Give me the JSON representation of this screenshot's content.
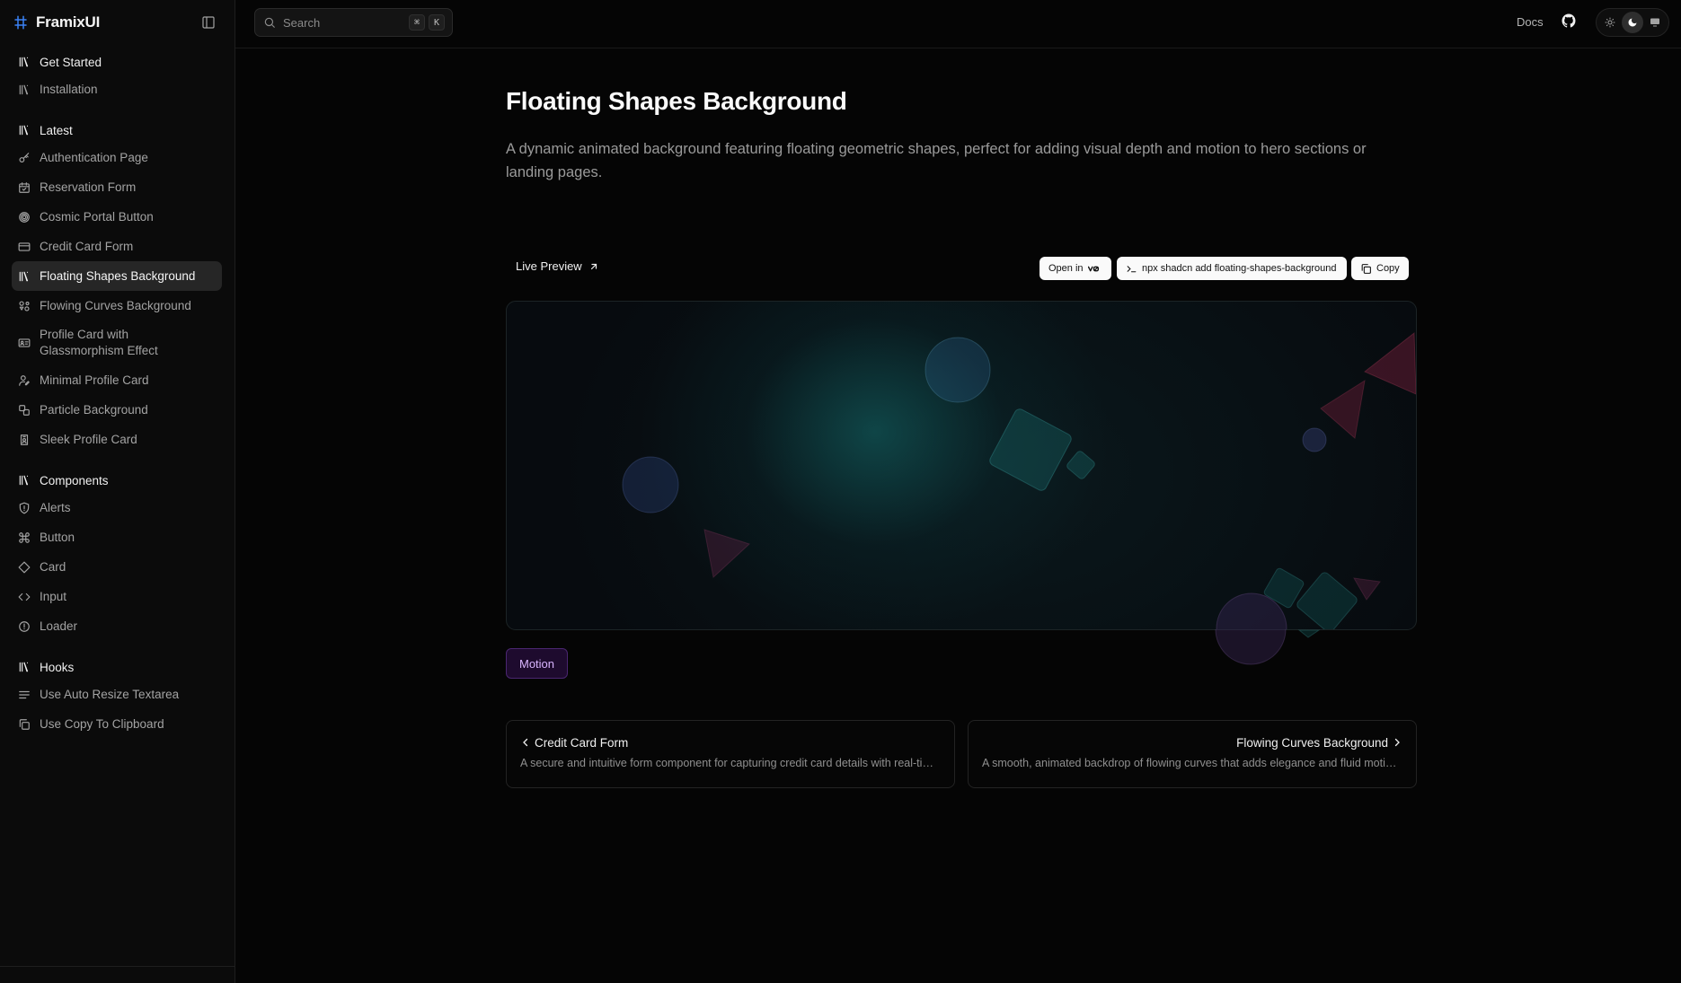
{
  "app": {
    "name": "FramixUI"
  },
  "sidebar": {
    "sections": [
      {
        "title": "Get Started",
        "icon": "library-icon",
        "items": [
          {
            "label": "Installation",
            "icon": "library-icon"
          }
        ]
      },
      {
        "title": "Latest",
        "icon": "library-icon",
        "items": [
          {
            "label": "Authentication Page",
            "icon": "key-icon"
          },
          {
            "label": "Reservation Form",
            "icon": "calendar-check-icon"
          },
          {
            "label": "Cosmic Portal Button",
            "icon": "target-icon"
          },
          {
            "label": "Credit Card Form",
            "icon": "credit-card-icon"
          },
          {
            "label": "Floating Shapes Background",
            "icon": "library-icon",
            "active": true
          },
          {
            "label": "Flowing Curves Background",
            "icon": "shapes-icon"
          },
          {
            "label": "Profile Card with Glassmorphism Effect",
            "icon": "id-card-icon"
          },
          {
            "label": "Minimal Profile Card",
            "icon": "user-pen-icon"
          },
          {
            "label": "Particle Background",
            "icon": "blend-icon"
          },
          {
            "label": "Sleek Profile Card",
            "icon": "badge-user-icon"
          }
        ]
      },
      {
        "title": "Components",
        "icon": "library-icon",
        "items": [
          {
            "label": "Alerts",
            "icon": "shield-alert-icon"
          },
          {
            "label": "Button",
            "icon": "command-icon"
          },
          {
            "label": "Card",
            "icon": "diamond-icon"
          },
          {
            "label": "Input",
            "icon": "code-icon"
          },
          {
            "label": "Loader",
            "icon": "alert-circle-icon"
          }
        ]
      },
      {
        "title": "Hooks",
        "icon": "library-icon",
        "items": [
          {
            "label": "Use Auto Resize Textarea",
            "icon": "text-lines-icon"
          },
          {
            "label": "Use Copy To Clipboard",
            "icon": "copy-icon"
          }
        ]
      }
    ]
  },
  "topbar": {
    "search_placeholder": "Search",
    "shortcut_mod": "⌘",
    "shortcut_key": "K",
    "docs_label": "Docs"
  },
  "page": {
    "title": "Floating Shapes Background",
    "description": "A dynamic animated background featuring floating geometric shapes, perfect for adding visual depth and motion to hero sections or landing pages."
  },
  "preview_bar": {
    "live_preview_label": "Live Preview",
    "open_in_label": "Open in",
    "cli_command": "npx shadcn add floating-shapes-background",
    "copy_label": "Copy"
  },
  "tags": [
    "Motion"
  ],
  "pager": {
    "prev": {
      "title": "Credit Card Form",
      "description": "A secure and intuitive form component for capturing credit card details with real-time validation and formatting."
    },
    "next": {
      "title": "Flowing Curves Background",
      "description": "A smooth, animated backdrop of flowing curves that adds elegance and fluid motion to your pages."
    }
  },
  "colors": {
    "accent": "#3b82f6",
    "tag_text": "#d8b4fe",
    "tag_bg": "#1e0b2e",
    "preview_glow": "#146e6e"
  }
}
